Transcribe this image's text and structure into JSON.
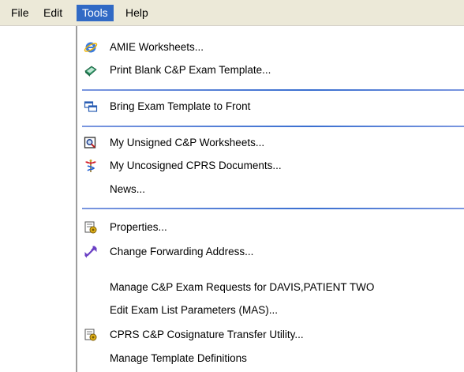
{
  "menubar": {
    "items": [
      {
        "label": "File"
      },
      {
        "label": "Edit"
      },
      {
        "label": "Tools"
      },
      {
        "label": "Help"
      }
    ]
  },
  "tools_menu": {
    "items": [
      {
        "label": "AMIE Worksheets...",
        "icon": "ie-globe-icon"
      },
      {
        "label": "Print Blank C&P Exam Template...",
        "icon": "book-icon"
      },
      {
        "label": "Bring Exam Template to Front",
        "icon": "windows-stack-icon"
      },
      {
        "label": "My Unsigned C&P Worksheets...",
        "icon": "search-document-icon"
      },
      {
        "label": "My Uncosigned CPRS Documents...",
        "icon": "caduceus-icon"
      },
      {
        "label": "News..."
      },
      {
        "label": "Properties...",
        "icon": "properties-icon"
      },
      {
        "label": "Change Forwarding Address...",
        "icon": "double-arrow-icon"
      },
      {
        "label": "Manage C&P Exam Requests for DAVIS,PATIENT TWO"
      },
      {
        "label": "Edit Exam List Parameters (MAS)..."
      },
      {
        "label": "CPRS C&P Cosignature Transfer Utility...",
        "icon": "properties-icon"
      },
      {
        "label": "Manage Template Definitions"
      }
    ]
  }
}
